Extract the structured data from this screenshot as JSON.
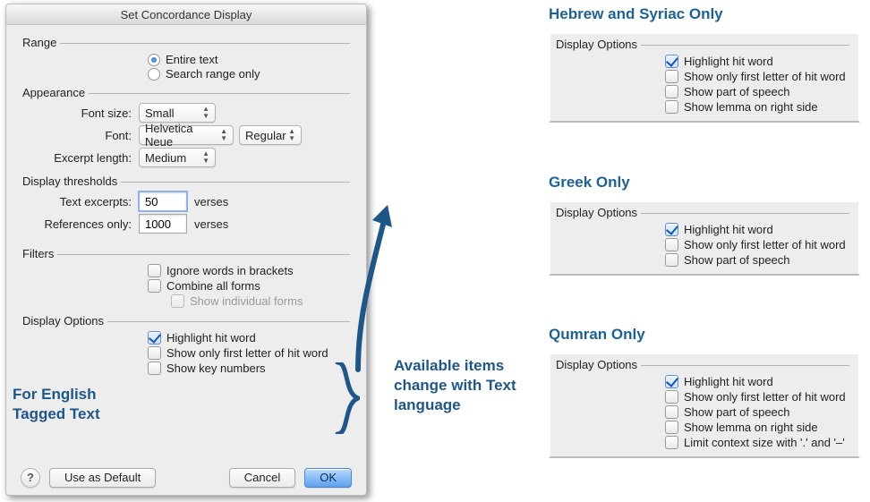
{
  "dialog": {
    "title": "Set Concordance Display",
    "range": {
      "legend": "Range",
      "entire_text": "Entire text",
      "search_range_only": "Search range only"
    },
    "appearance": {
      "legend": "Appearance",
      "font_size_label": "Font size:",
      "font_size_value": "Small",
      "font_label": "Font:",
      "font_value": "Helvetica Neue",
      "font_style_value": "Regular",
      "excerpt_label": "Excerpt length:",
      "excerpt_value": "Medium"
    },
    "thresholds": {
      "legend": "Display thresholds",
      "text_excerpts_label": "Text excerpts:",
      "text_excerpts_value": "50",
      "references_label": "References only:",
      "references_value": "1000",
      "verses_suffix": "verses"
    },
    "filters": {
      "legend": "Filters",
      "ignore_brackets": "Ignore words in brackets",
      "combine": "Combine all forms",
      "show_individual": "Show individual forms"
    },
    "display_options": {
      "legend": "Display Options",
      "highlight": "Highlight hit word",
      "first_letter": "Show only first letter of hit word",
      "key_numbers": "Show key numbers"
    },
    "footer": {
      "use_default": "Use as Default",
      "cancel": "Cancel",
      "ok": "OK",
      "help": "?"
    }
  },
  "annotations": {
    "english": "For English Tagged Text",
    "change": "Available items change with Text language"
  },
  "panels": {
    "hebrew": {
      "heading": "Hebrew and Syriac Only",
      "legend": "Display Options",
      "items": [
        {
          "label": "Highlight hit word",
          "checked": true
        },
        {
          "label": "Show only first letter of hit word",
          "checked": false
        },
        {
          "label": "Show part of speech",
          "checked": false
        },
        {
          "label": "Show lemma on right side",
          "checked": false
        }
      ]
    },
    "greek": {
      "heading": "Greek Only",
      "legend": "Display Options",
      "items": [
        {
          "label": "Highlight hit word",
          "checked": true
        },
        {
          "label": "Show only first letter of hit word",
          "checked": false
        },
        {
          "label": "Show part of speech",
          "checked": false
        }
      ]
    },
    "qumran": {
      "heading": "Qumran Only",
      "legend": "Display Options",
      "items": [
        {
          "label": "Highlight hit word",
          "checked": true
        },
        {
          "label": "Show only first letter of hit word",
          "checked": false
        },
        {
          "label": "Show part of speech",
          "checked": false
        },
        {
          "label": "Show lemma on right side",
          "checked": false
        },
        {
          "label": "Limit context size with '.' and '–'",
          "checked": false
        }
      ]
    }
  }
}
